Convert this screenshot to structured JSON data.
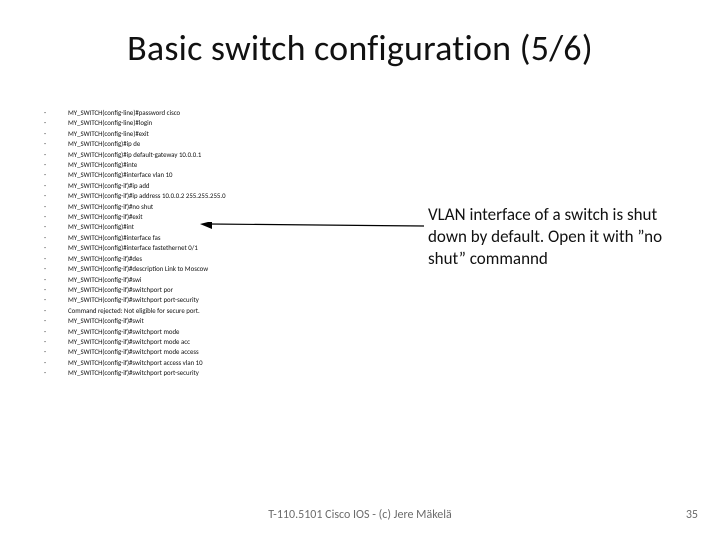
{
  "title": "Basic switch configuration (5/6)",
  "configLines": [
    "MY_SWITCH(config-line)#password cisco",
    "MY_SWITCH(config-line)#login",
    "MY_SWITCH(config-line)#exit",
    "MY_SWITCH(config)#ip de",
    "MY_SWITCH(config)#ip default-gateway 10.0.0.1",
    "MY_SWITCH(config)#inte",
    "MY_SWITCH(config)#interface vlan 10",
    "MY_SWITCH(config-if)#ip add",
    "MY_SWITCH(config-if)#ip address 10.0.0.2 255.255.255.0",
    "MY_SWITCH(config-if)#no shut",
    "MY_SWITCH(config-if)#exit",
    "MY_SWITCH(config)#int",
    "MY_SWITCH(config)#interface fas",
    "MY_SWITCH(config)#interface fastethernet 0/1",
    "MY_SWITCH(config-if)#des",
    "MY_SWITCH(config-if)#description Link to Moscow",
    "MY_SWITCH(config-if)#swi",
    "MY_SWITCH(config-if)#switchport por",
    "MY_SWITCH(config-if)#switchport port-security",
    "Command rejected: Not eligible for secure port.",
    "MY_SWITCH(config-if)#swit",
    "MY_SWITCH(config-if)#switchport mode",
    "MY_SWITCH(config-if)#switchport mode acc",
    "MY_SWITCH(config-if)#switchport mode access",
    "MY_SWITCH(config-if)#switchport access vlan 10",
    "MY_SWITCH(config-if)#switchport port-security"
  ],
  "annotation": "VLAN interface of a switch is shut down by default. Open it with ”no shut” commannd",
  "footerCenter": "T-110.5101 Cisco IOS - (c) Jere Mäkelä",
  "footerRight": "35"
}
